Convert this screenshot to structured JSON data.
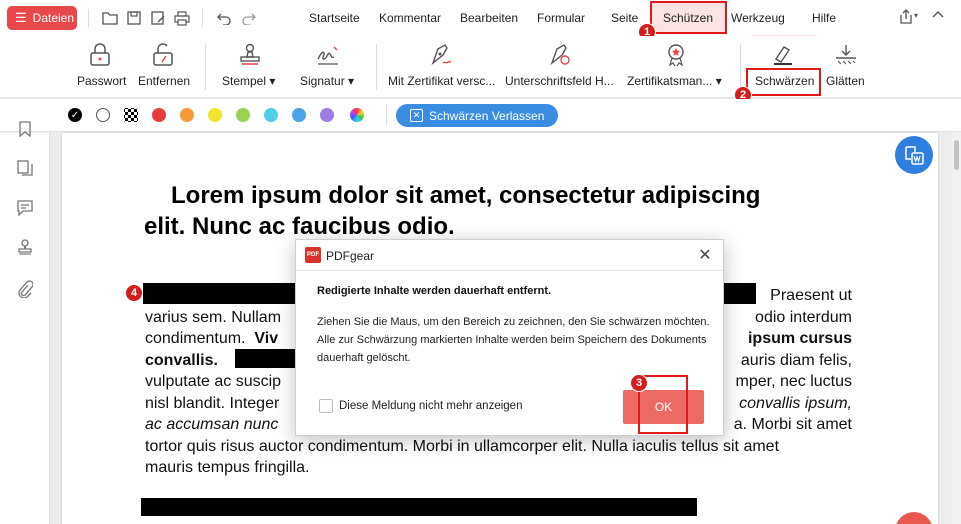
{
  "menubar": {
    "file_label": "Dateien",
    "items": [
      "Startseite",
      "Kommentar",
      "Bearbeiten",
      "Formular",
      "Seite",
      "Schützen",
      "Werkzeug",
      "Hilfe"
    ],
    "active": "Schützen"
  },
  "ribbon": {
    "buttons": [
      {
        "label": "Passwort",
        "icon": "lock-icon"
      },
      {
        "label": "Entfernen",
        "icon": "unlock-icon"
      },
      {
        "label": "Stempel ▾",
        "icon": "stamp-icon"
      },
      {
        "label": "Signatur ▾",
        "icon": "signature-icon"
      },
      {
        "label": "Mit Zertifikat versc...",
        "icon": "certificate-pen-icon"
      },
      {
        "label": "Unterschriftsfeld H...",
        "icon": "signature-field-icon"
      },
      {
        "label": "Zertifikatsman... ▾",
        "icon": "certificate-manager-icon"
      },
      {
        "label": "Schwärzen",
        "icon": "redact-icon"
      },
      {
        "label": "Glätten",
        "icon": "flatten-icon"
      }
    ],
    "selected": "Schwärzen"
  },
  "colorbar": {
    "colors": [
      "#000000",
      "#ffffff",
      "checker",
      "#e83b3b",
      "#f59a38",
      "#f2e32c",
      "#9ad150",
      "#4fd0e8",
      "#4aa3e8",
      "#9d7de0",
      "rainbow"
    ],
    "exit_label": "Schwärzen Verlassen"
  },
  "sidebar": {
    "icons": [
      "bookmark-icon",
      "pages-icon",
      "comment-icon",
      "stamp-icon",
      "attachment-icon"
    ]
  },
  "document": {
    "title_line1": "Lorem ipsum dolor sit amet, consectetur adipiscing",
    "title_line2": "elit. Nunc ac faucibus odio.",
    "row1_end": "Praesent ut",
    "row2_a": "varius sem. Nullam",
    "row2_b": "odio interdum",
    "row3_a": "condimentum.",
    "row3_a2": "Viv",
    "row3_b": "ipsum cursus",
    "row4_a": "convallis.",
    "row4_b": "auris diam felis,",
    "row5_a": "vulputate ac suscip",
    "row5_b": "mper, nec luctus",
    "row6_a": "nisl blandit. Integer",
    "row6_b": "convallis ipsum,",
    "row7_a": "ac accumsan nunc",
    "row7_b": "a. Morbi sit amet",
    "row8": "tortor quis risus auctor condimentum. Morbi in ullamcorper elit. Nulla iaculis tellus sit amet",
    "row9": "mauris tempus fringilla."
  },
  "dialog": {
    "title": "PDFgear",
    "logo_text": "PDF",
    "heading": "Redigierte Inhalte werden dauerhaft entfernt.",
    "body": "Ziehen Sie die Maus, um den Bereich zu zeichnen, den Sie schwärzen möchten. Alle zur Schwärzung markierten Inhalte werden beim Speichern des Dokuments dauerhaft gelöscht.",
    "checkbox_label": "Diese Meldung nicht mehr anzeigen",
    "ok_label": "OK"
  },
  "annotations": [
    "1",
    "2",
    "3",
    "4"
  ],
  "colors": {
    "accent_red": "#e0191a",
    "brand_red": "#e8484a",
    "primary_blue": "#3b8de3",
    "ok_button": "#eb6a64"
  }
}
